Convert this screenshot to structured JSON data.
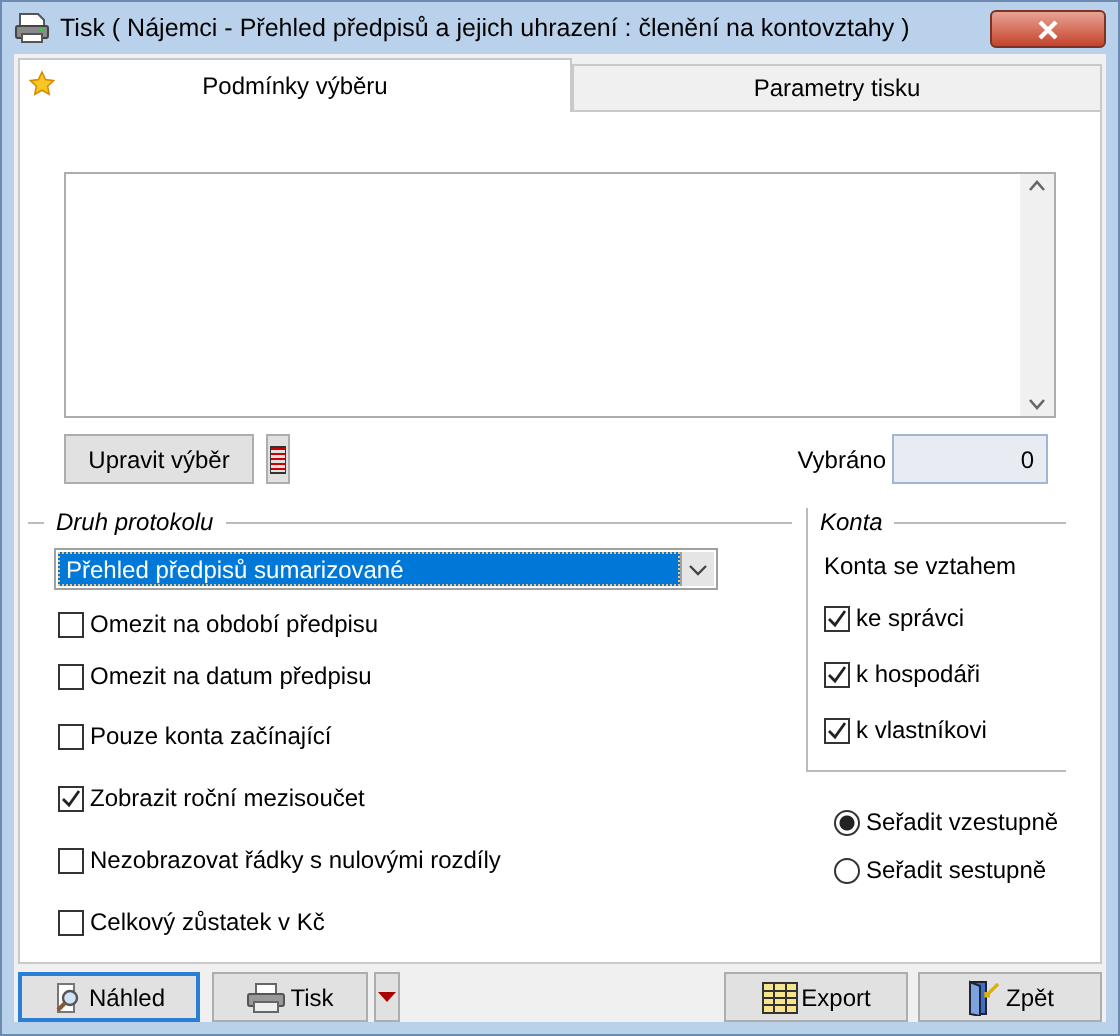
{
  "window": {
    "title": "Tisk ( Nájemci - Přehled předpisů a jejich uhrazení : členění na kontovztahy )"
  },
  "tabs": [
    {
      "label": "Podmínky výběru",
      "selected": true
    },
    {
      "label": "Parametry tisku",
      "selected": false
    }
  ],
  "selection": {
    "edit_button": "Upravit výběr",
    "count_label": "Vybráno",
    "count": "0"
  },
  "report_type": {
    "title": "Druh protokolu",
    "dropdown": "Přehled předpisů sumarizované",
    "options": [
      {
        "label": "Omezit na období předpisu",
        "checked": false
      },
      {
        "label": "Omezit na datum předpisu",
        "checked": false
      },
      {
        "label": "Pouze konta začínající",
        "checked": false
      },
      {
        "label": "Zobrazit roční mezisoučet",
        "checked": true
      },
      {
        "label": "Nezobrazovat řádky s nulovými rozdíly",
        "checked": false
      },
      {
        "label": "Celkový zůstatek v Kč",
        "checked": false
      }
    ]
  },
  "accounts": {
    "title": "Konta",
    "subtitle": "Konta se vztahem",
    "options": [
      {
        "label": "ke správci",
        "checked": true
      },
      {
        "label": "k hospodáři",
        "checked": true
      },
      {
        "label": "k vlastníkovi",
        "checked": true
      }
    ]
  },
  "sort": [
    {
      "label": "Seřadit vzestupně",
      "selected": true
    },
    {
      "label": "Seřadit sestupně",
      "selected": false
    }
  ],
  "buttons": [
    {
      "label": "Náhled",
      "kind": "preview",
      "default": true
    },
    {
      "label": "Tisk",
      "kind": "print",
      "default": false
    },
    {
      "label": "Export",
      "kind": "export",
      "default": false
    },
    {
      "label": "Zpět",
      "kind": "back",
      "default": false
    }
  ]
}
